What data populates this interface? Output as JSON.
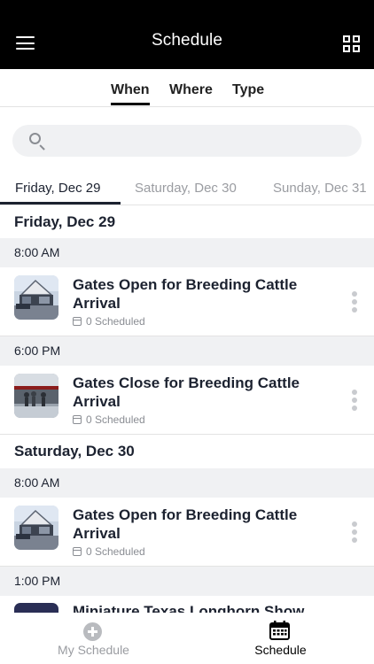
{
  "header": {
    "title": "Schedule",
    "menu_icon": "hamburger-menu-icon",
    "view_icon": "grid-view-icon",
    "background": "#000000"
  },
  "filter_tabs": [
    {
      "label": "When",
      "active": true
    },
    {
      "label": "Where",
      "active": false
    },
    {
      "label": "Type",
      "active": false
    }
  ],
  "search": {
    "value": "",
    "placeholder": "",
    "icon": "search-icon"
  },
  "day_tabs": [
    {
      "label": "Friday, Dec 29",
      "active": true
    },
    {
      "label": "Saturday, Dec 30",
      "active": false
    },
    {
      "label": "Sunday, Dec 31",
      "active": false
    }
  ],
  "sections": [
    {
      "date": "Friday, Dec 29",
      "groups": [
        {
          "time": "8:00 AM",
          "events": [
            {
              "title": "Gates Open for Breeding Cattle Arrival",
              "scheduled": "0 Scheduled"
            }
          ]
        },
        {
          "time": "6:00 PM",
          "events": [
            {
              "title": "Gates Close for Breeding Cattle Arrival",
              "scheduled": "0 Scheduled"
            }
          ]
        }
      ]
    },
    {
      "date": "Saturday, Dec 30",
      "groups": [
        {
          "time": "8:00 AM",
          "events": [
            {
              "title": "Gates Open for Breeding Cattle Arrival",
              "scheduled": "0 Scheduled"
            }
          ]
        },
        {
          "time": "1:00 PM",
          "events": [
            {
              "title": "Miniature Texas Longhorn Show",
              "scheduled": ""
            }
          ]
        }
      ]
    }
  ],
  "bottom_nav": [
    {
      "label": "My Schedule",
      "icon": "plus-circle-icon",
      "active": false
    },
    {
      "label": "Schedule",
      "icon": "calendar-icon",
      "active": true
    }
  ],
  "colors": {
    "accent": "#000000",
    "text": "#1c2230",
    "muted": "#9a9ca1",
    "row_bg": "#f0f1f3"
  }
}
